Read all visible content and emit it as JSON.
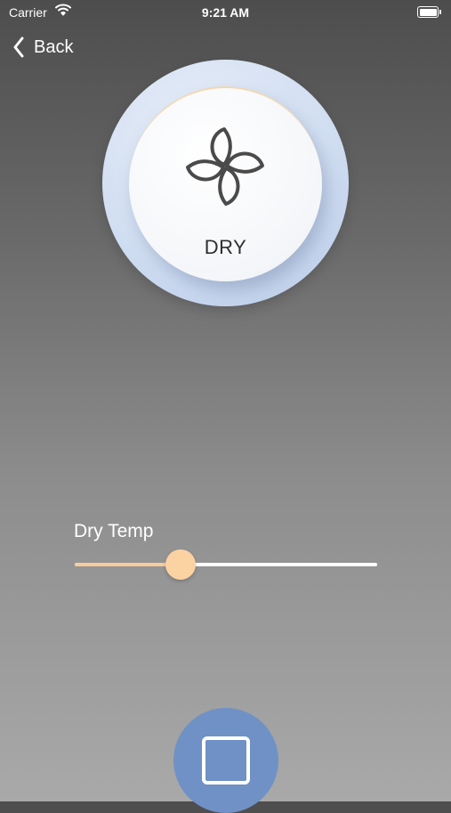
{
  "status_bar": {
    "carrier": "Carrier",
    "time": "9:21 AM",
    "wifi_icon": "wifi-icon",
    "battery_icon": "battery-icon"
  },
  "nav": {
    "back_label": "Back",
    "back_icon": "chevron-left-icon"
  },
  "mode": {
    "label": "DRY",
    "icon": "fan-icon"
  },
  "temperature": {
    "label": "Dry Temp",
    "value_fraction": 0.35
  },
  "control": {
    "icon": "stop-icon"
  },
  "colors": {
    "accent_peach": "#fbd2a2",
    "button_blue": "#6f91c6",
    "dial_blue": "#d2dff2"
  }
}
